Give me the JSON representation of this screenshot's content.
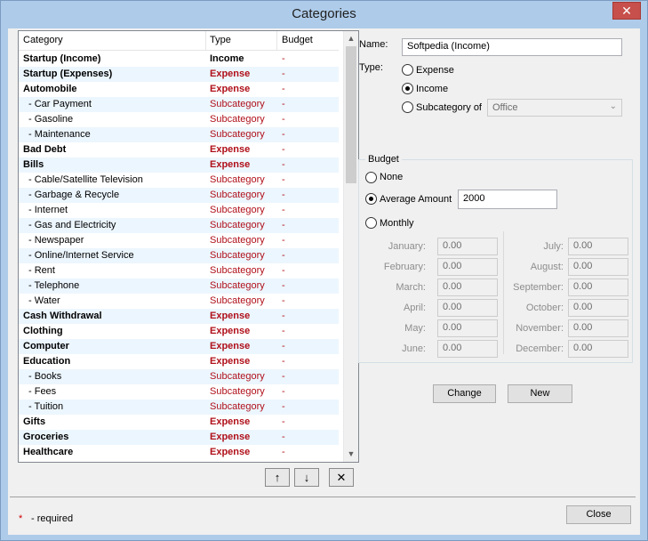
{
  "window": {
    "title": "Categories",
    "close_glyph": "✕"
  },
  "list": {
    "headers": {
      "category": "Category",
      "type": "Type",
      "budget": "Budget"
    },
    "rows": [
      {
        "category": "Startup (Income)",
        "type": "Income",
        "budget": "-",
        "parent": true
      },
      {
        "category": "Startup (Expenses)",
        "type": "Expense",
        "budget": "-",
        "parent": true
      },
      {
        "category": "Automobile",
        "type": "Expense",
        "budget": "-",
        "parent": true
      },
      {
        "category": "-  Car Payment",
        "type": "Subcategory",
        "budget": "-",
        "parent": false
      },
      {
        "category": "-  Gasoline",
        "type": "Subcategory",
        "budget": "-",
        "parent": false
      },
      {
        "category": "-  Maintenance",
        "type": "Subcategory",
        "budget": "-",
        "parent": false
      },
      {
        "category": "Bad Debt",
        "type": "Expense",
        "budget": "-",
        "parent": true
      },
      {
        "category": "Bills",
        "type": "Expense",
        "budget": "-",
        "parent": true
      },
      {
        "category": "-  Cable/Satellite Television",
        "type": "Subcategory",
        "budget": "-",
        "parent": false
      },
      {
        "category": "-  Garbage & Recycle",
        "type": "Subcategory",
        "budget": "-",
        "parent": false
      },
      {
        "category": "-  Internet",
        "type": "Subcategory",
        "budget": "-",
        "parent": false
      },
      {
        "category": "-  Gas and Electricity",
        "type": "Subcategory",
        "budget": "-",
        "parent": false
      },
      {
        "category": "-  Newspaper",
        "type": "Subcategory",
        "budget": "-",
        "parent": false
      },
      {
        "category": "-  Online/Internet Service",
        "type": "Subcategory",
        "budget": "-",
        "parent": false
      },
      {
        "category": "-  Rent",
        "type": "Subcategory",
        "budget": "-",
        "parent": false
      },
      {
        "category": "-  Telephone",
        "type": "Subcategory",
        "budget": "-",
        "parent": false
      },
      {
        "category": "-  Water",
        "type": "Subcategory",
        "budget": "-",
        "parent": false
      },
      {
        "category": "Cash Withdrawal",
        "type": "Expense",
        "budget": "-",
        "parent": true
      },
      {
        "category": "Clothing",
        "type": "Expense",
        "budget": "-",
        "parent": true
      },
      {
        "category": "Computer",
        "type": "Expense",
        "budget": "-",
        "parent": true
      },
      {
        "category": "Education",
        "type": "Expense",
        "budget": "-",
        "parent": true
      },
      {
        "category": "-  Books",
        "type": "Subcategory",
        "budget": "-",
        "parent": false
      },
      {
        "category": "-  Fees",
        "type": "Subcategory",
        "budget": "-",
        "parent": false
      },
      {
        "category": "-  Tuition",
        "type": "Subcategory",
        "budget": "-",
        "parent": false
      },
      {
        "category": "Gifts",
        "type": "Expense",
        "budget": "-",
        "parent": true
      },
      {
        "category": "Groceries",
        "type": "Expense",
        "budget": "-",
        "parent": true
      },
      {
        "category": "Healthcare",
        "type": "Expense",
        "budget": "-",
        "parent": true
      }
    ]
  },
  "list_buttons": {
    "up": "↑",
    "down": "↓",
    "delete": "✕"
  },
  "form": {
    "name_label": "Name:",
    "name_value": "Softpedia (Income)",
    "type_label": "Type:",
    "type_options": {
      "expense": "Expense",
      "income": "Income",
      "subcategory": "Subcategory of"
    },
    "type_selected": "income",
    "subcategory_value": "Office",
    "budget": {
      "legend": "Budget",
      "options": {
        "none": "None",
        "average": "Average Amount",
        "monthly": "Monthly"
      },
      "selected": "average",
      "average_value": "2000",
      "months": [
        {
          "label": "January:",
          "value": "0.00"
        },
        {
          "label": "February:",
          "value": "0.00"
        },
        {
          "label": "March:",
          "value": "0.00"
        },
        {
          "label": "April:",
          "value": "0.00"
        },
        {
          "label": "May:",
          "value": "0.00"
        },
        {
          "label": "June:",
          "value": "0.00"
        },
        {
          "label": "July:",
          "value": "0.00"
        },
        {
          "label": "August:",
          "value": "0.00"
        },
        {
          "label": "September:",
          "value": "0.00"
        },
        {
          "label": "October:",
          "value": "0.00"
        },
        {
          "label": "November:",
          "value": "0.00"
        },
        {
          "label": "December:",
          "value": "0.00"
        }
      ]
    },
    "change_label": "Change",
    "new_label": "New"
  },
  "footer": {
    "required_star": "*",
    "required_text": "- required",
    "close_label": "Close"
  },
  "colors": {
    "expense": "#b0101a",
    "alt_row": "#ecf6fe",
    "titlebar": "#aecbe9",
    "close_button": "#c7504c"
  }
}
